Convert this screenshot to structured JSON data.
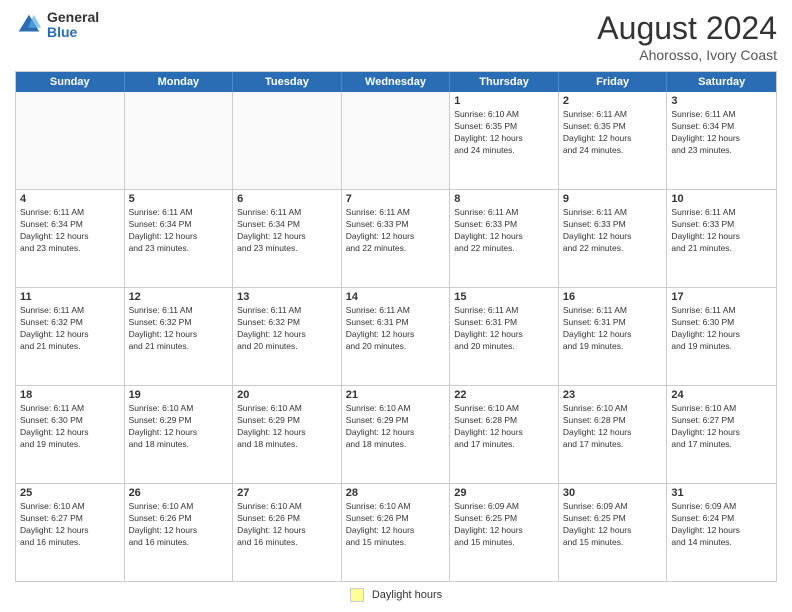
{
  "logo": {
    "general": "General",
    "blue": "Blue"
  },
  "title": {
    "month_year": "August 2024",
    "location": "Ahorosso, Ivory Coast"
  },
  "header_days": [
    "Sunday",
    "Monday",
    "Tuesday",
    "Wednesday",
    "Thursday",
    "Friday",
    "Saturday"
  ],
  "weeks": [
    [
      {
        "day": "",
        "info": ""
      },
      {
        "day": "",
        "info": ""
      },
      {
        "day": "",
        "info": ""
      },
      {
        "day": "",
        "info": ""
      },
      {
        "day": "1",
        "info": "Sunrise: 6:10 AM\nSunset: 6:35 PM\nDaylight: 12 hours\nand 24 minutes."
      },
      {
        "day": "2",
        "info": "Sunrise: 6:11 AM\nSunset: 6:35 PM\nDaylight: 12 hours\nand 24 minutes."
      },
      {
        "day": "3",
        "info": "Sunrise: 6:11 AM\nSunset: 6:34 PM\nDaylight: 12 hours\nand 23 minutes."
      }
    ],
    [
      {
        "day": "4",
        "info": "Sunrise: 6:11 AM\nSunset: 6:34 PM\nDaylight: 12 hours\nand 23 minutes."
      },
      {
        "day": "5",
        "info": "Sunrise: 6:11 AM\nSunset: 6:34 PM\nDaylight: 12 hours\nand 23 minutes."
      },
      {
        "day": "6",
        "info": "Sunrise: 6:11 AM\nSunset: 6:34 PM\nDaylight: 12 hours\nand 23 minutes."
      },
      {
        "day": "7",
        "info": "Sunrise: 6:11 AM\nSunset: 6:33 PM\nDaylight: 12 hours\nand 22 minutes."
      },
      {
        "day": "8",
        "info": "Sunrise: 6:11 AM\nSunset: 6:33 PM\nDaylight: 12 hours\nand 22 minutes."
      },
      {
        "day": "9",
        "info": "Sunrise: 6:11 AM\nSunset: 6:33 PM\nDaylight: 12 hours\nand 22 minutes."
      },
      {
        "day": "10",
        "info": "Sunrise: 6:11 AM\nSunset: 6:33 PM\nDaylight: 12 hours\nand 21 minutes."
      }
    ],
    [
      {
        "day": "11",
        "info": "Sunrise: 6:11 AM\nSunset: 6:32 PM\nDaylight: 12 hours\nand 21 minutes."
      },
      {
        "day": "12",
        "info": "Sunrise: 6:11 AM\nSunset: 6:32 PM\nDaylight: 12 hours\nand 21 minutes."
      },
      {
        "day": "13",
        "info": "Sunrise: 6:11 AM\nSunset: 6:32 PM\nDaylight: 12 hours\nand 20 minutes."
      },
      {
        "day": "14",
        "info": "Sunrise: 6:11 AM\nSunset: 6:31 PM\nDaylight: 12 hours\nand 20 minutes."
      },
      {
        "day": "15",
        "info": "Sunrise: 6:11 AM\nSunset: 6:31 PM\nDaylight: 12 hours\nand 20 minutes."
      },
      {
        "day": "16",
        "info": "Sunrise: 6:11 AM\nSunset: 6:31 PM\nDaylight: 12 hours\nand 19 minutes."
      },
      {
        "day": "17",
        "info": "Sunrise: 6:11 AM\nSunset: 6:30 PM\nDaylight: 12 hours\nand 19 minutes."
      }
    ],
    [
      {
        "day": "18",
        "info": "Sunrise: 6:11 AM\nSunset: 6:30 PM\nDaylight: 12 hours\nand 19 minutes."
      },
      {
        "day": "19",
        "info": "Sunrise: 6:10 AM\nSunset: 6:29 PM\nDaylight: 12 hours\nand 18 minutes."
      },
      {
        "day": "20",
        "info": "Sunrise: 6:10 AM\nSunset: 6:29 PM\nDaylight: 12 hours\nand 18 minutes."
      },
      {
        "day": "21",
        "info": "Sunrise: 6:10 AM\nSunset: 6:29 PM\nDaylight: 12 hours\nand 18 minutes."
      },
      {
        "day": "22",
        "info": "Sunrise: 6:10 AM\nSunset: 6:28 PM\nDaylight: 12 hours\nand 17 minutes."
      },
      {
        "day": "23",
        "info": "Sunrise: 6:10 AM\nSunset: 6:28 PM\nDaylight: 12 hours\nand 17 minutes."
      },
      {
        "day": "24",
        "info": "Sunrise: 6:10 AM\nSunset: 6:27 PM\nDaylight: 12 hours\nand 17 minutes."
      }
    ],
    [
      {
        "day": "25",
        "info": "Sunrise: 6:10 AM\nSunset: 6:27 PM\nDaylight: 12 hours\nand 16 minutes."
      },
      {
        "day": "26",
        "info": "Sunrise: 6:10 AM\nSunset: 6:26 PM\nDaylight: 12 hours\nand 16 minutes."
      },
      {
        "day": "27",
        "info": "Sunrise: 6:10 AM\nSunset: 6:26 PM\nDaylight: 12 hours\nand 16 minutes."
      },
      {
        "day": "28",
        "info": "Sunrise: 6:10 AM\nSunset: 6:26 PM\nDaylight: 12 hours\nand 15 minutes."
      },
      {
        "day": "29",
        "info": "Sunrise: 6:09 AM\nSunset: 6:25 PM\nDaylight: 12 hours\nand 15 minutes."
      },
      {
        "day": "30",
        "info": "Sunrise: 6:09 AM\nSunset: 6:25 PM\nDaylight: 12 hours\nand 15 minutes."
      },
      {
        "day": "31",
        "info": "Sunrise: 6:09 AM\nSunset: 6:24 PM\nDaylight: 12 hours\nand 14 minutes."
      }
    ]
  ],
  "legend": {
    "box_label": "Daylight hours"
  }
}
